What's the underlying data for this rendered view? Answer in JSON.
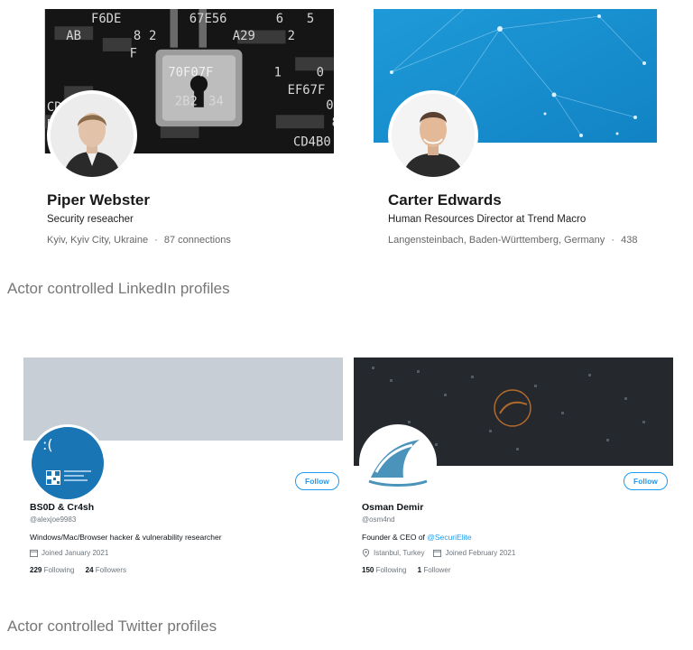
{
  "linkedin": {
    "profiles": [
      {
        "name": "Piper Webster",
        "headline": "Security reseacher",
        "location": "Kyiv, Kyiv City, Ukraine",
        "separator": "·",
        "connections": "87 connections",
        "banner_glyphs": [
          "F6DE",
          "67E56",
          "6",
          "5",
          "D",
          "AB",
          "8",
          "2",
          "A29",
          "2",
          "F",
          "70F07F",
          "1",
          "0",
          "EF67F",
          "2B2",
          "34",
          "CD4B",
          "8",
          "BA",
          "0",
          "CD4B0"
        ]
      },
      {
        "name": "Carter Edwards",
        "headline": "Human Resources Director at Trend Macro",
        "location": "Langensteinbach, Baden-Württemberg, Germany",
        "separator": "·",
        "connections": "438"
      }
    ],
    "caption": "Actor controlled LinkedIn profiles"
  },
  "twitter": {
    "profiles": [
      {
        "name": "BS0D & Cr4sh",
        "handle": "@alexjoe9983",
        "bio": "Windows/Mac/Browser hacker & vulnerability researcher",
        "joined": "Joined January 2021",
        "following_count": "229",
        "following_label": "Following",
        "followers_count": "24",
        "followers_label": "Followers",
        "follow_label": "Follow",
        "avatar_text": ":("
      },
      {
        "name": "Osman Demir",
        "handle": "@osm4nd",
        "bio_prefix": "Founder & CEO of",
        "bio_link": "@SecuriElite",
        "location": "Istanbul, Turkey",
        "joined": "Joined February 2021",
        "following_count": "150",
        "following_label": "Following",
        "followers_count": "1",
        "followers_label": "Follower",
        "follow_label": "Follow"
      }
    ],
    "caption": "Actor controlled Twitter profiles"
  },
  "colors": {
    "linkedin_blue_banner": "#1e96d2",
    "twitter_link": "#1d9bf0",
    "twitter_gray_banner": "#c7ced5",
    "dark_banner": "#25292e",
    "bsod_blue": "#1a75b4"
  }
}
